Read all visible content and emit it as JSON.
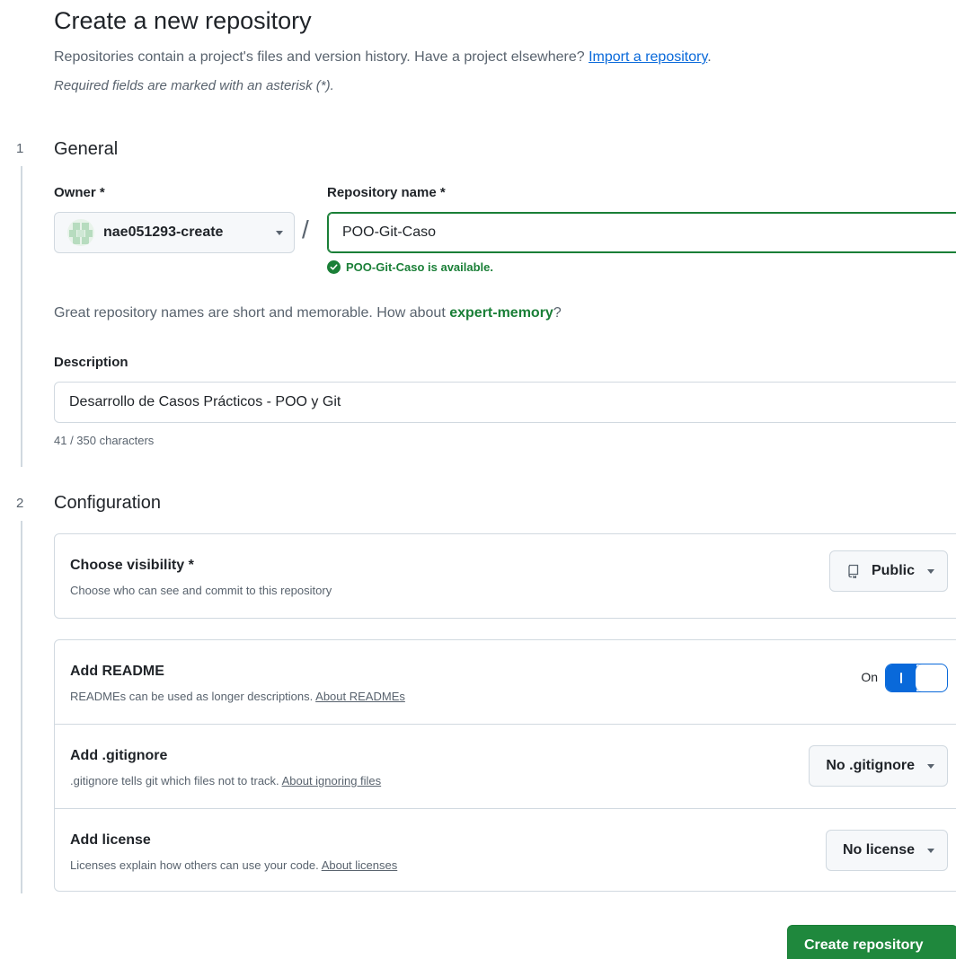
{
  "header": {
    "title": "Create a new repository",
    "subtitle_text": "Repositories contain a project's files and version history. Have a project elsewhere?",
    "import_link": "Import a repository",
    "subtitle_end": ".",
    "required_note": "Required fields are marked with an asterisk (*)."
  },
  "general": {
    "step": "1",
    "heading": "General",
    "owner_label": "Owner *",
    "owner_value": "nae051293-create",
    "separator": "/",
    "repo_name_label": "Repository name *",
    "repo_name_value": "POO-Git-Caso",
    "availability": "POO-Git-Caso is available.",
    "hint_prefix": "Great repository names are short and memorable. How about ",
    "hint_suggestion": "expert-memory",
    "hint_suffix": "?",
    "description_label": "Description",
    "description_value": "Desarrollo de Casos Prácticos - POO y Git",
    "char_count": "41 / 350 characters"
  },
  "configuration": {
    "step": "2",
    "heading": "Configuration",
    "visibility": {
      "title": "Choose visibility *",
      "description": "Choose who can see and commit to this repository",
      "value": "Public",
      "icon": "repo-icon"
    },
    "readme": {
      "title": "Add README",
      "description": "READMEs can be used as longer descriptions.",
      "link": "About READMEs",
      "toggle_label": "On",
      "enabled": true
    },
    "gitignore": {
      "title": "Add .gitignore",
      "description": ".gitignore tells git which files not to track.",
      "link": "About ignoring files",
      "value": "No .gitignore"
    },
    "license": {
      "title": "Add license",
      "description": "Licenses explain how others can use your code.",
      "link": "About licenses",
      "value": "No license"
    }
  },
  "actions": {
    "create_label": "Create repository"
  },
  "colors": {
    "accent_green": "#1f883d",
    "success_text": "#1a7f37",
    "link_blue": "#0969da",
    "border": "#d1d9e0",
    "muted_text": "#59636e"
  }
}
